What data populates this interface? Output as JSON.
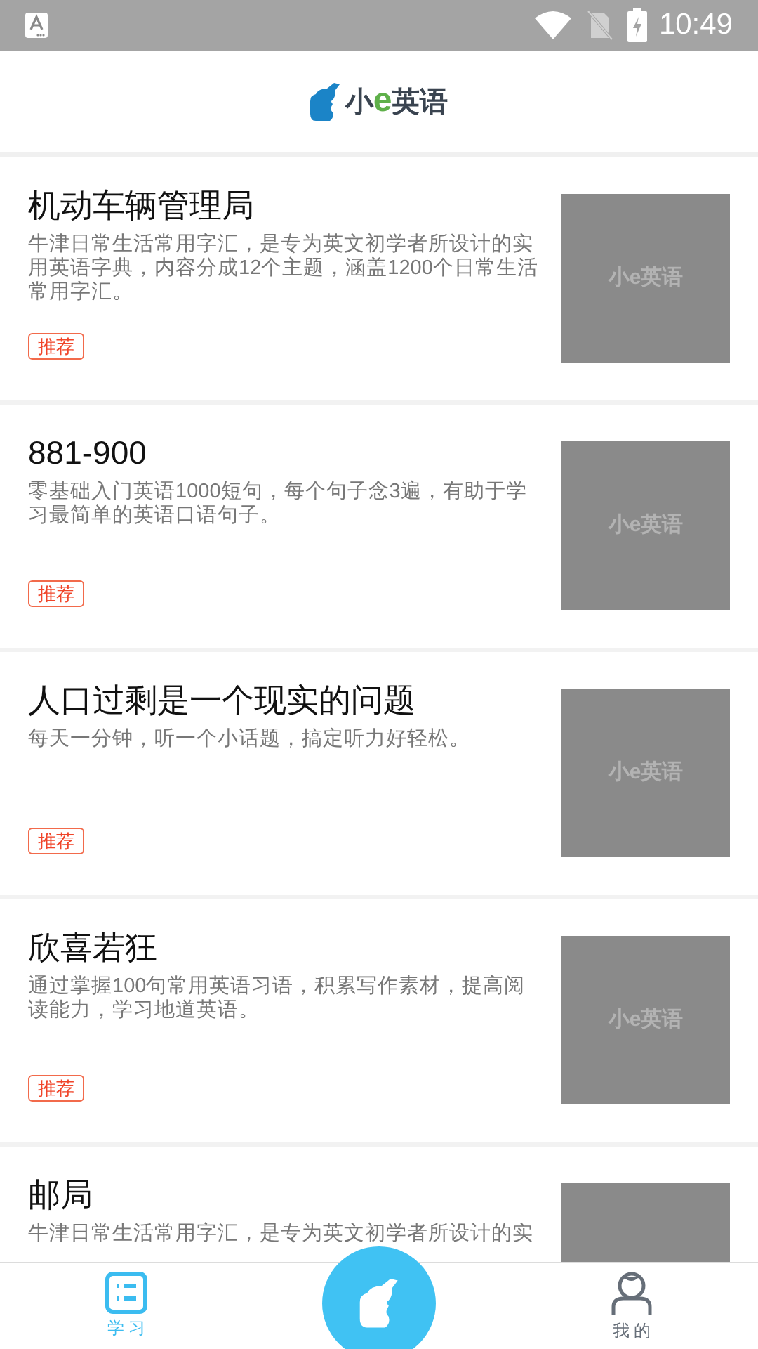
{
  "status_bar": {
    "time": "10:49"
  },
  "header": {
    "logo": {
      "before": "小",
      "accent": "e",
      "after": "英语"
    }
  },
  "cards": [
    {
      "title": "机动车辆管理局",
      "description": "牛津日常生活常用字汇，是专为英文初学者所设计的实用英语字典，内容分成12个主题，涵盖1200个日常生活常用字汇。",
      "tag": "推荐",
      "thumbnail_label": "小e英语"
    },
    {
      "title": "881-900",
      "description": "零基础入门英语1000短句，每个句子念3遍，有助于学习最简单的英语口语句子。",
      "tag": "推荐",
      "thumbnail_label": "小e英语"
    },
    {
      "title": "人口过剩是一个现实的问题",
      "description": "每天一分钟，听一个小话题，搞定听力好轻松。",
      "tag": "推荐",
      "thumbnail_label": "小e英语"
    },
    {
      "title": "欣喜若狂",
      "description": "通过掌握100句常用英语习语，积累写作素材，提高阅读能力，学习地道英语。",
      "tag": "推荐",
      "thumbnail_label": "小e英语"
    },
    {
      "title": "邮局",
      "description": "牛津日常生活常用字汇，是专为英文初学者所设计的实"
    }
  ],
  "tabs": [
    {
      "kind": "study",
      "label": "学 习",
      "selected": true
    },
    {
      "kind": "center",
      "selected": false
    },
    {
      "kind": "profile",
      "label": "我 的",
      "selected": false
    }
  ]
}
